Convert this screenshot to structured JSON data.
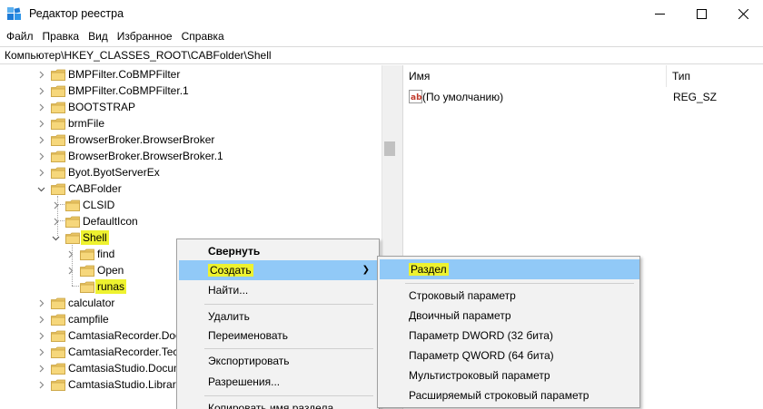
{
  "window": {
    "title": "Редактор реестра"
  },
  "menubar": [
    "Файл",
    "Правка",
    "Вид",
    "Избранное",
    "Справка"
  ],
  "address": "Компьютер\\HKEY_CLASSES_ROOT\\CABFolder\\Shell",
  "tree": {
    "items": [
      {
        "label": "BMPFilter.CoBMPFilter",
        "expanded": false,
        "level": 0
      },
      {
        "label": "BMPFilter.CoBMPFilter.1",
        "expanded": false,
        "level": 0
      },
      {
        "label": "BOOTSTRAP",
        "expanded": false,
        "level": 0
      },
      {
        "label": "brmFile",
        "expanded": false,
        "level": 0
      },
      {
        "label": "BrowserBroker.BrowserBroker",
        "expanded": false,
        "level": 0
      },
      {
        "label": "BrowserBroker.BrowserBroker.1",
        "expanded": false,
        "level": 0
      },
      {
        "label": "Byot.ByotServerEx",
        "expanded": false,
        "level": 0
      },
      {
        "label": "CABFolder",
        "expanded": true,
        "level": 0
      },
      {
        "label": "CLSID",
        "expanded": false,
        "level": 1
      },
      {
        "label": "DefaultIcon",
        "expanded": false,
        "level": 1
      },
      {
        "label": "Shell",
        "expanded": true,
        "level": 1,
        "highlighted": true
      },
      {
        "label": "find",
        "expanded": false,
        "level": 2
      },
      {
        "label": "Open",
        "expanded": false,
        "level": 2
      },
      {
        "label": "runas",
        "expanded": false,
        "level": 2,
        "highlighted": true
      },
      {
        "label": "calculator",
        "expanded": false,
        "level": 0
      },
      {
        "label": "campfile",
        "expanded": false,
        "level": 0
      },
      {
        "label": "CamtasiaRecorder.Doc",
        "expanded": false,
        "level": 0
      },
      {
        "label": "CamtasiaRecorder.Tech",
        "expanded": false,
        "level": 0
      },
      {
        "label": "CamtasiaStudio.Docum",
        "expanded": false,
        "level": 0
      },
      {
        "label": "CamtasiaStudio.Library",
        "expanded": false,
        "level": 0
      }
    ]
  },
  "list": {
    "columns": {
      "name": "Имя",
      "type": "Тип"
    },
    "rows": [
      {
        "name": "(По умолчанию)",
        "type": "REG_SZ",
        "icon": "string-value-icon"
      }
    ]
  },
  "context_menu": {
    "items": [
      {
        "label": "Свернуть",
        "bold": true
      },
      {
        "label": "Создать",
        "submenu": true,
        "selected": true,
        "highlighted": true
      },
      {
        "label": "Найти..."
      },
      {
        "label": "Удалить"
      },
      {
        "label": "Переименовать"
      },
      {
        "label": "Экспортировать"
      },
      {
        "label": "Разрешения..."
      },
      {
        "label": "Копировать имя раздела"
      }
    ]
  },
  "submenu": {
    "items": [
      {
        "label": "Раздел",
        "selected": true,
        "highlighted": true
      },
      {
        "label": "Строковый параметр"
      },
      {
        "label": "Двоичный параметр"
      },
      {
        "label": "Параметр DWORD (32 бита)"
      },
      {
        "label": "Параметр QWORD (64 бита)"
      },
      {
        "label": "Мультистроковый параметр"
      },
      {
        "label": "Расширяемый строковый параметр"
      }
    ]
  },
  "colors": {
    "highlight": "#eef22f",
    "menu_selection": "#91c9f7",
    "folder": "#e8c466"
  }
}
